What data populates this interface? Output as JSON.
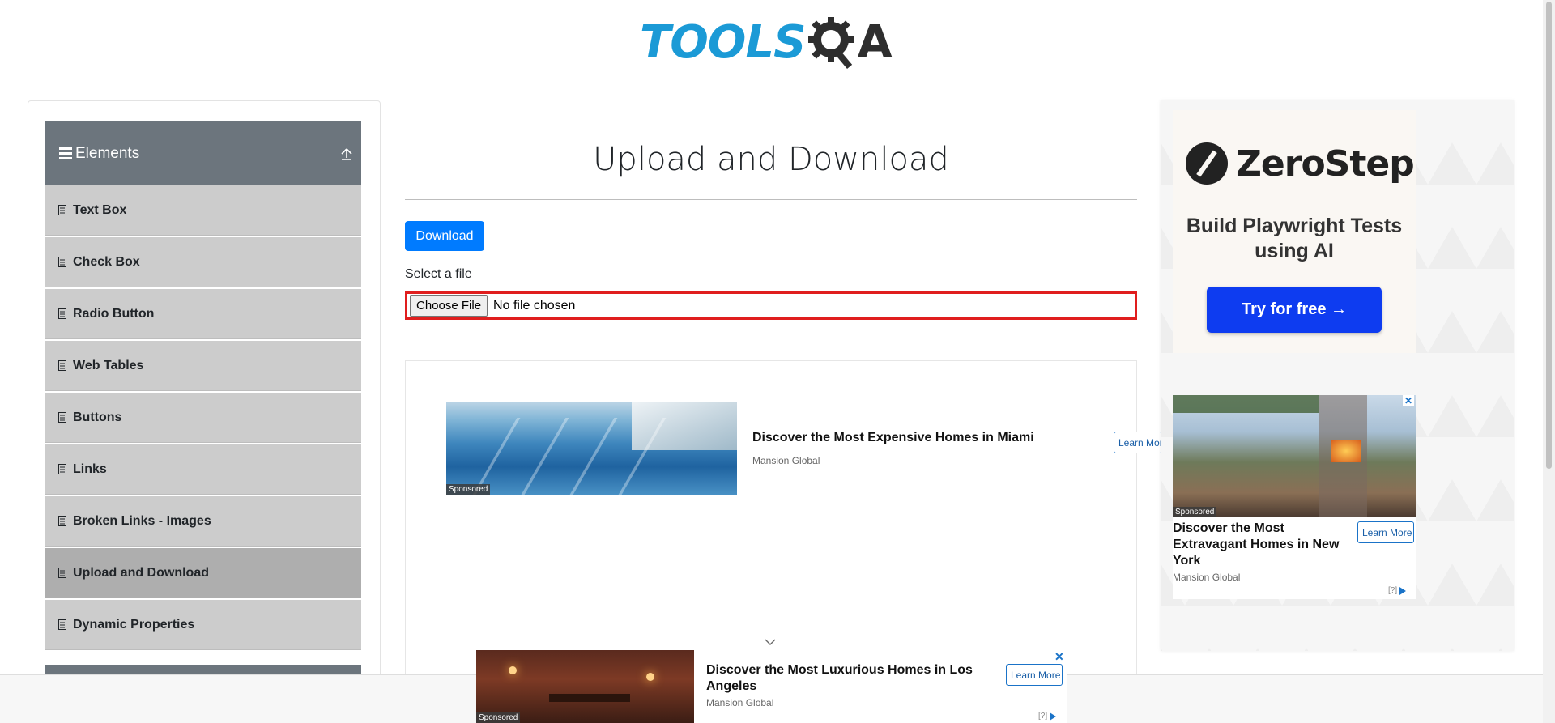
{
  "header": {
    "logo_text": "TOOLS",
    "logo_suffix": "A"
  },
  "sidebar": {
    "group_title": "Elements",
    "items": [
      {
        "label": "Text Box"
      },
      {
        "label": "Check Box"
      },
      {
        "label": "Radio Button"
      },
      {
        "label": "Web Tables"
      },
      {
        "label": "Buttons"
      },
      {
        "label": "Links"
      },
      {
        "label": "Broken Links - Images"
      },
      {
        "label": "Upload and Download",
        "active": true
      },
      {
        "label": "Dynamic Properties"
      }
    ]
  },
  "main": {
    "title": "Upload and Download",
    "download_label": "Download",
    "select_label": "Select a file",
    "choose_file_label": "Choose File",
    "file_status": "No file chosen"
  },
  "ads": {
    "inline": {
      "title": "Discover the Most Expensive Homes in Miami",
      "source": "Mansion Global",
      "cta": "Learn More",
      "badge": "Sponsored"
    },
    "bottom": {
      "title": "Discover the Most Luxurious Homes in Los Angeles",
      "source": "Mansion Global",
      "cta": "Learn More",
      "badge": "Sponsored",
      "adchoice": "[?]"
    },
    "side_promo": {
      "brand": "ZeroStep",
      "tagline": "Build Playwright Tests using AI",
      "cta": "Try for free →"
    },
    "side": {
      "title": "Discover the Most Extravagant Homes in New York",
      "source": "Mansion Global",
      "cta": "Learn More",
      "badge": "Sponsored",
      "adchoice": "[?]"
    }
  },
  "colors": {
    "accent": "#007bff",
    "sidebar_header": "#6c757d",
    "highlight": "#e01e1e",
    "logo_blue": "#1b9ad6"
  }
}
